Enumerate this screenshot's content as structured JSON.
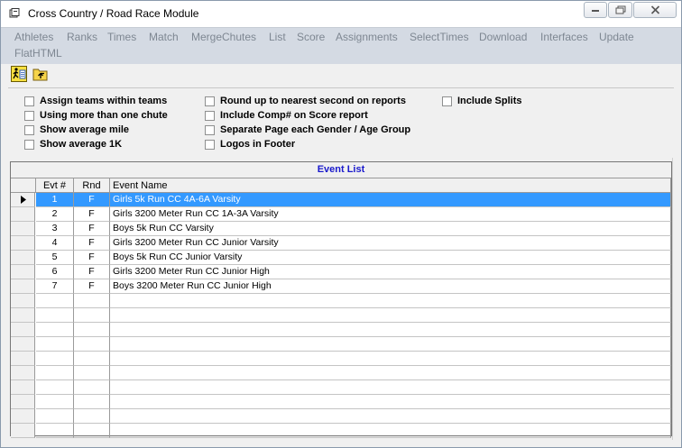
{
  "window": {
    "title": "Cross Country / Road Race Module"
  },
  "menu": [
    "Athletes",
    "Ranks",
    "Times",
    "Match",
    "MergeChutes",
    "List",
    "Score",
    "Assignments",
    "SelectTimes",
    "Download",
    "Interfaces",
    "Update",
    "FlatHTML"
  ],
  "toolbar": {
    "icons": [
      "runner-results-icon",
      "folder-up-icon"
    ]
  },
  "options": [
    {
      "label": "Assign teams within teams",
      "checked": false
    },
    {
      "label": "Using more than one chute",
      "checked": false
    },
    {
      "label": "Show average mile",
      "checked": false
    },
    {
      "label": "Show average 1K",
      "checked": false
    },
    {
      "label": "Round up to nearest second on reports",
      "checked": false
    },
    {
      "label": "Include Comp# on Score report",
      "checked": false
    },
    {
      "label": "Separate Page each Gender / Age Group",
      "checked": false
    },
    {
      "label": "Logos in Footer",
      "checked": false
    },
    {
      "label": "Include Splits",
      "checked": false
    }
  ],
  "event_list": {
    "caption": "Event List",
    "columns": [
      "Evt #",
      "Rnd",
      "Event Name"
    ],
    "rows": [
      {
        "evt": "1",
        "rnd": "F",
        "name": "Girls 5k Run CC 4A-6A Varsity"
      },
      {
        "evt": "2",
        "rnd": "F",
        "name": "Girls 3200 Meter Run CC 1A-3A Varsity"
      },
      {
        "evt": "3",
        "rnd": "F",
        "name": "Boys 5k Run CC Varsity"
      },
      {
        "evt": "4",
        "rnd": "F",
        "name": "Girls 3200 Meter Run CC Junior Varsity"
      },
      {
        "evt": "5",
        "rnd": "F",
        "name": "Boys 5k Run CC Junior Varsity"
      },
      {
        "evt": "6",
        "rnd": "F",
        "name": "Girls 3200 Meter Run CC Junior High"
      },
      {
        "evt": "7",
        "rnd": "F",
        "name": "Boys 3200 Meter Run CC Junior High"
      }
    ],
    "selected_row": 0,
    "empty_rows": 10
  },
  "colors": {
    "selection": "#3399ff",
    "caption_text": "#1a1acc",
    "menu_bg": "#d4dae3",
    "menu_text": "#7e8792"
  }
}
